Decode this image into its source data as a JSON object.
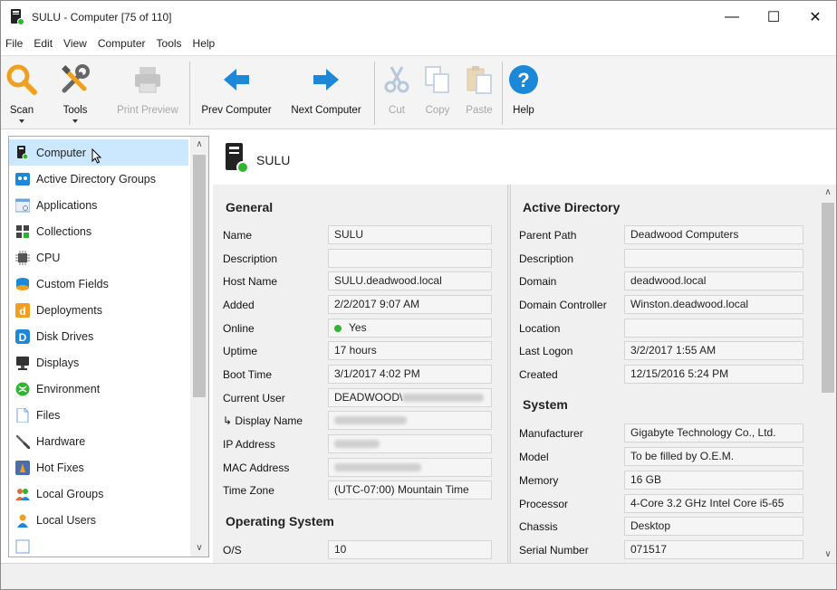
{
  "window": {
    "title": "SULU - Computer [75 of 110]",
    "controls": {
      "minimize": "—",
      "maximize": "☐",
      "close": "✕"
    }
  },
  "menu": [
    "File",
    "Edit",
    "View",
    "Computer",
    "Tools",
    "Help"
  ],
  "toolbar": {
    "scan": "Scan",
    "tools": "Tools",
    "print_preview": "Print Preview",
    "prev_computer": "Prev Computer",
    "next_computer": "Next Computer",
    "cut": "Cut",
    "copy": "Copy",
    "paste": "Paste",
    "help": "Help"
  },
  "sidebar": {
    "items": [
      {
        "label": "Computer",
        "icon": "computer-icon",
        "selected": true
      },
      {
        "label": "Active Directory Groups",
        "icon": "ad-groups-icon"
      },
      {
        "label": "Applications",
        "icon": "applications-icon"
      },
      {
        "label": "Collections",
        "icon": "collections-icon"
      },
      {
        "label": "CPU",
        "icon": "cpu-icon"
      },
      {
        "label": "Custom Fields",
        "icon": "custom-fields-icon"
      },
      {
        "label": "Deployments",
        "icon": "deployments-icon"
      },
      {
        "label": "Disk Drives",
        "icon": "disk-drives-icon"
      },
      {
        "label": "Displays",
        "icon": "displays-icon"
      },
      {
        "label": "Environment",
        "icon": "environment-icon"
      },
      {
        "label": "Files",
        "icon": "files-icon"
      },
      {
        "label": "Hardware",
        "icon": "hardware-icon"
      },
      {
        "label": "Hot Fixes",
        "icon": "hot-fixes-icon"
      },
      {
        "label": "Local Groups",
        "icon": "local-groups-icon"
      },
      {
        "label": "Local Users",
        "icon": "local-users-icon"
      }
    ]
  },
  "content": {
    "computer_name": "SULU",
    "general": {
      "title": "General",
      "rows": [
        {
          "label": "Name",
          "value": "SULU"
        },
        {
          "label": "Description",
          "value": ""
        },
        {
          "label": "Host Name",
          "value": "SULU.deadwood.local"
        },
        {
          "label": "Added",
          "value": "2/2/2017 9:07 AM"
        },
        {
          "label": "Online",
          "value": "Yes"
        },
        {
          "label": "Uptime",
          "value": "17 hours"
        },
        {
          "label": "Boot Time",
          "value": "3/1/2017 4:02 PM"
        },
        {
          "label": "Current User",
          "value": "DEADWOOD\\"
        },
        {
          "label": "↳ Display Name",
          "value": ""
        },
        {
          "label": "IP Address",
          "value": ""
        },
        {
          "label": "MAC Address",
          "value": ""
        },
        {
          "label": "Time Zone",
          "value": "(UTC-07:00) Mountain Time"
        }
      ]
    },
    "operating_system": {
      "title": "Operating System",
      "rows": [
        {
          "label": "O/S",
          "value": "10"
        }
      ]
    },
    "active_directory": {
      "title": "Active Directory",
      "rows": [
        {
          "label": "Parent Path",
          "value": "Deadwood Computers"
        },
        {
          "label": "Description",
          "value": ""
        },
        {
          "label": "Domain",
          "value": "deadwood.local"
        },
        {
          "label": "Domain Controller",
          "value": "Winston.deadwood.local"
        },
        {
          "label": "Location",
          "value": ""
        },
        {
          "label": "Last Logon",
          "value": "3/2/2017 1:55 AM"
        },
        {
          "label": "Created",
          "value": "12/15/2016 5:24 PM"
        }
      ]
    },
    "system": {
      "title": "System",
      "rows": [
        {
          "label": "Manufacturer",
          "value": "Gigabyte Technology Co., Ltd."
        },
        {
          "label": "Model",
          "value": "To be filled by O.E.M."
        },
        {
          "label": "Memory",
          "value": "16 GB"
        },
        {
          "label": "Processor",
          "value": "4-Core 3.2 GHz Intel Core i5-65"
        },
        {
          "label": "Chassis",
          "value": "Desktop"
        },
        {
          "label": "Serial Number",
          "value": "071517"
        }
      ]
    }
  },
  "colors": {
    "selected": "#cce8ff",
    "accent_blue": "#1e88d8",
    "online": "#2fb52f",
    "scan_orange": "#f0a020"
  }
}
